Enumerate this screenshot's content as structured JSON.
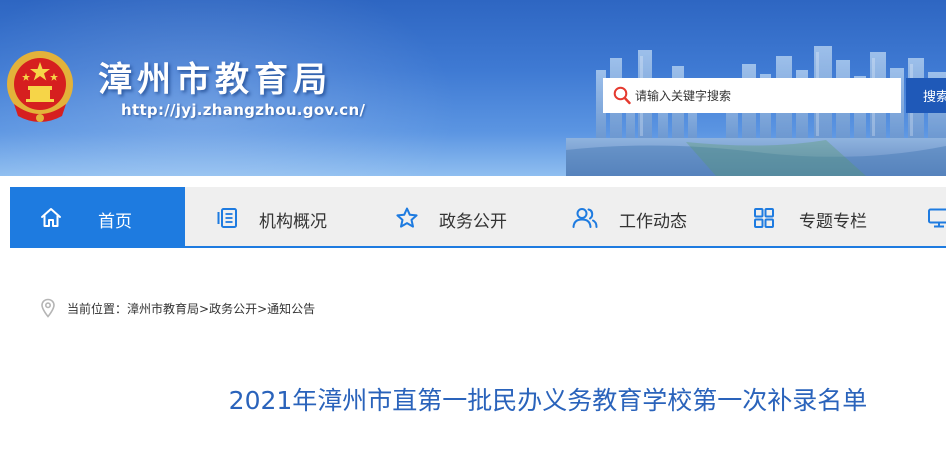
{
  "header": {
    "title": "漳州市教育局",
    "url": "http://jyj.zhangzhou.gov.cn/",
    "emblem_icon": "national-emblem-icon",
    "search": {
      "placeholder": "请输入关键字搜索",
      "button_label": "搜索"
    }
  },
  "nav": {
    "items": [
      {
        "label": "首页",
        "icon": "home-icon",
        "active": true
      },
      {
        "label": "机构概况",
        "icon": "document-icon",
        "active": false
      },
      {
        "label": "政务公开",
        "icon": "star-icon",
        "active": false
      },
      {
        "label": "工作动态",
        "icon": "users-icon",
        "active": false
      },
      {
        "label": "专题专栏",
        "icon": "grid-icon",
        "active": false
      }
    ],
    "partial_icon": "monitor-icon"
  },
  "breadcrumb": {
    "prefix": "当前位置：",
    "items": [
      "漳州市教育局",
      "政务公开",
      "通知公告"
    ],
    "separator": ">"
  },
  "article": {
    "title": "2021年漳州市直第一批民办义务教育学校第一次补录名单"
  },
  "colors": {
    "header_blue": "#3f7ad3",
    "nav_active": "#1e7be0",
    "nav_background": "#efefef",
    "title_blue": "#2a63bb",
    "search_button": "#1f59b8"
  }
}
